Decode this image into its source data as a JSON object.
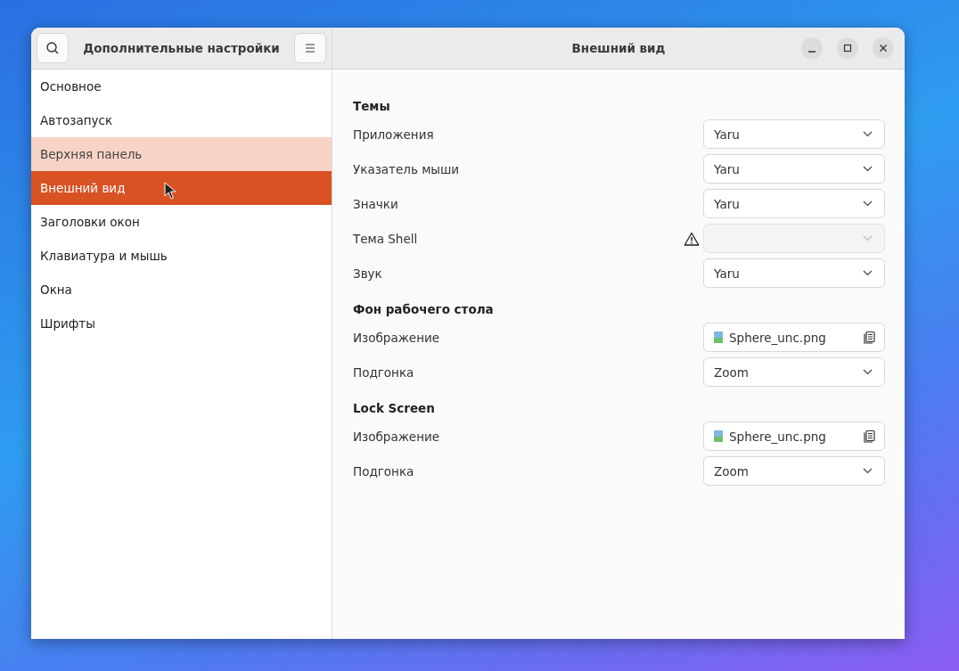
{
  "sidebar": {
    "title": "Дополнительные настройки",
    "items": [
      {
        "label": "Основное",
        "selected": false,
        "hovered": false,
        "pointer": false
      },
      {
        "label": "Автозапуск",
        "selected": false,
        "hovered": false,
        "pointer": false
      },
      {
        "label": "Верхняя панель",
        "selected": false,
        "hovered": true,
        "pointer": false
      },
      {
        "label": "Внешний вид",
        "selected": true,
        "hovered": false,
        "pointer": true
      },
      {
        "label": "Заголовки окон",
        "selected": false,
        "hovered": false,
        "pointer": false
      },
      {
        "label": "Клавиатура и мышь",
        "selected": false,
        "hovered": false,
        "pointer": false
      },
      {
        "label": "Окна",
        "selected": false,
        "hovered": false,
        "pointer": false
      },
      {
        "label": "Шрифты",
        "selected": false,
        "hovered": false,
        "pointer": false
      }
    ]
  },
  "window": {
    "title": "Внешний вид"
  },
  "sections": [
    {
      "heading": "Темы",
      "rows": [
        {
          "label": "Приложения",
          "kind": "dropdown",
          "value": "Yaru",
          "disabled": false,
          "warning": false
        },
        {
          "label": "Указатель мыши",
          "kind": "dropdown",
          "value": "Yaru",
          "disabled": false,
          "warning": false
        },
        {
          "label": "Значки",
          "kind": "dropdown",
          "value": "Yaru",
          "disabled": false,
          "warning": false
        },
        {
          "label": "Тема Shell",
          "kind": "dropdown",
          "disabled": true,
          "warning": true
        },
        {
          "label": "Звук",
          "kind": "dropdown",
          "value": "Yaru",
          "disabled": false,
          "warning": false
        }
      ]
    },
    {
      "heading": "Фон рабочего стола",
      "rows": [
        {
          "label": "Изображение",
          "kind": "file",
          "value": "Sphere_unc.png"
        },
        {
          "label": "Подгонка",
          "kind": "dropdown",
          "value": "Zoom",
          "disabled": false,
          "warning": false
        }
      ]
    },
    {
      "heading": "Lock Screen",
      "rows": [
        {
          "label": "Изображение",
          "kind": "file",
          "value": "Sphere_unc.png"
        },
        {
          "label": "Подгонка",
          "kind": "dropdown",
          "value": "Zoom",
          "disabled": false,
          "warning": false
        }
      ]
    }
  ]
}
